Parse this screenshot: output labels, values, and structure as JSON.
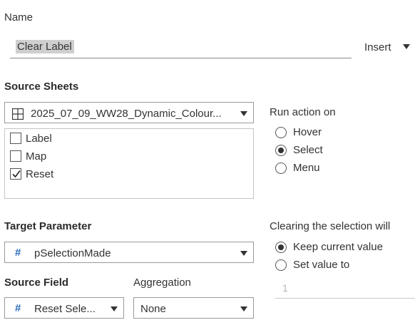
{
  "name": {
    "label": "Name",
    "value": "Clear Label",
    "insert_label": "Insert"
  },
  "source_sheets": {
    "label": "Source Sheets",
    "selected": "2025_07_09_WW28_Dynamic_Colour...",
    "items": [
      {
        "label": "Label",
        "checked": false
      },
      {
        "label": "Map",
        "checked": false
      },
      {
        "label": "Reset",
        "checked": true
      }
    ]
  },
  "run_action": {
    "label": "Run action on",
    "options": [
      {
        "label": "Hover",
        "checked": false
      },
      {
        "label": "Select",
        "checked": true
      },
      {
        "label": "Menu",
        "checked": false
      }
    ]
  },
  "target_parameter": {
    "label": "Target Parameter",
    "selected": "pSelectionMade"
  },
  "clearing": {
    "label": "Clearing the selection will",
    "options": [
      {
        "label": "Keep current value",
        "checked": true
      },
      {
        "label": "Set value to",
        "checked": false
      }
    ],
    "value": "1"
  },
  "source_field": {
    "label": "Source Field",
    "selected": "Reset Sele..."
  },
  "aggregation": {
    "label": "Aggregation",
    "selected": "None"
  },
  "colors": {
    "hash_icon": "#2a6ebb",
    "selection_highlight": "#cfcfcf"
  },
  "icons": {
    "sheet": "grid-sheet-icon",
    "parameter": "hash-icon",
    "dropdown": "chevron-down-icon"
  }
}
